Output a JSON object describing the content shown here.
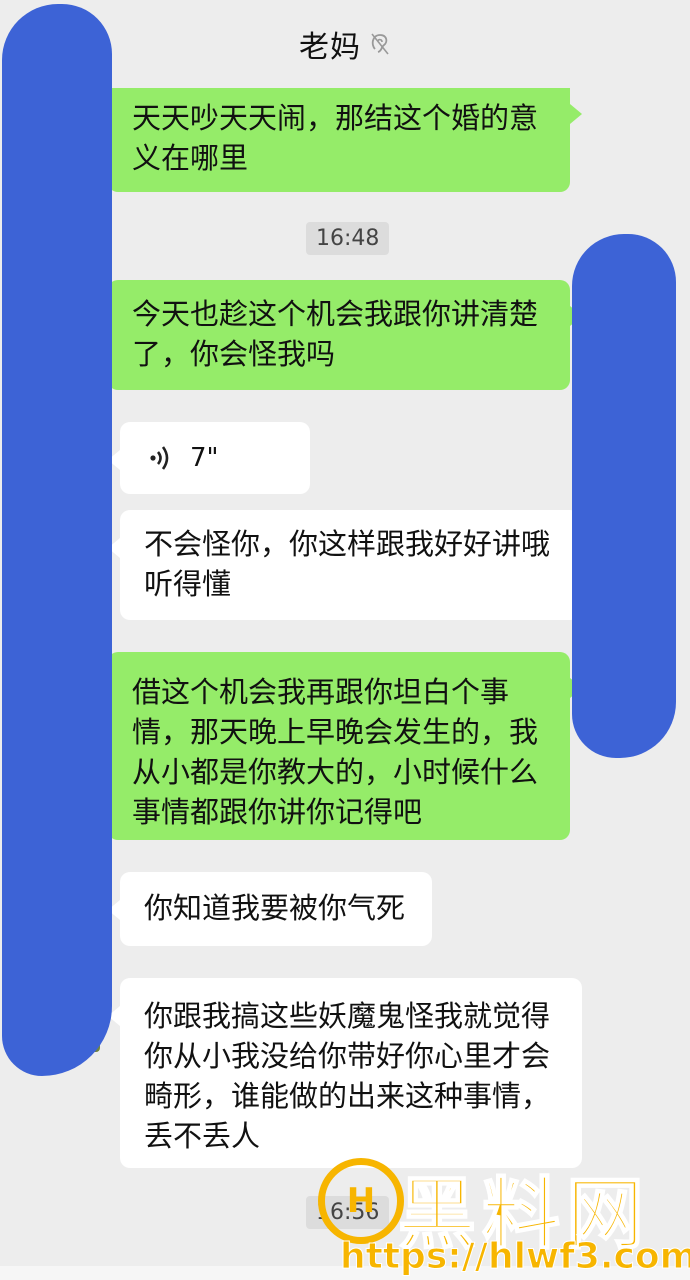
{
  "header": {
    "title": "老妈"
  },
  "messages": [
    {
      "side": "right",
      "text": "天天吵天天闹，那结这个婚的意义在哪里"
    },
    {
      "type": "time",
      "text": "16:48"
    },
    {
      "side": "right",
      "text": "今天也趁这个机会我跟你讲清楚了，你会怪我吗"
    },
    {
      "side": "left",
      "type": "voice",
      "duration": "7\""
    },
    {
      "side": "left",
      "text": "不会怪你，你这样跟我好好讲哦听得懂"
    },
    {
      "side": "right",
      "text": "借这个机会我再跟你坦白个事情，那天晚上早晚会发生的，我从小都是你教大的，小时候什么事情都跟你讲你记得吧"
    },
    {
      "side": "left",
      "text": "你知道我要被你气死"
    },
    {
      "side": "left",
      "text": "你跟我搞这些妖魔鬼怪我就觉得你从小我没给你带好你心里才会畸形，谁能做的出来这种事情，丢不丢人"
    },
    {
      "type": "time",
      "text": "16:56"
    }
  ],
  "watermark": {
    "logo": "H",
    "brand": "黑料网",
    "url": "https://hlwf3.com"
  },
  "icons": {
    "mute": "ear-mute-icon",
    "voice": "voice-wave-icon"
  },
  "colors": {
    "sent_bubble": "#95ec69",
    "received_bubble": "#ffffff",
    "background": "#ededed",
    "watermark": "#f7b500"
  }
}
